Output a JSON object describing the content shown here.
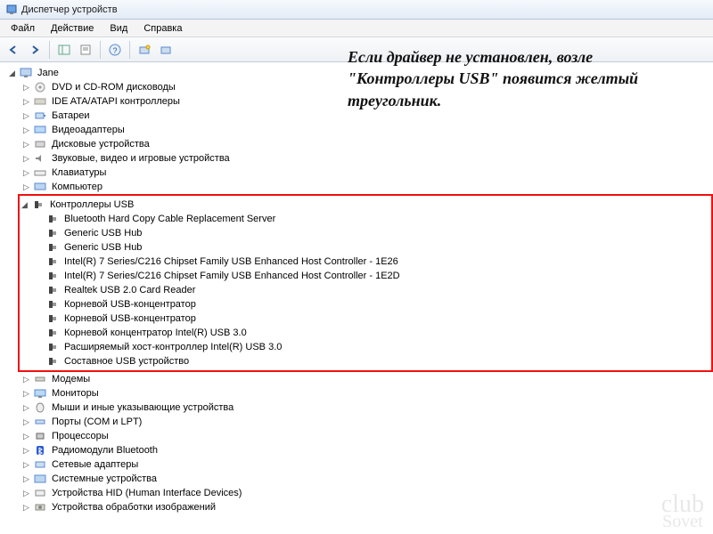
{
  "window": {
    "title": "Диспетчер устройств"
  },
  "menu": {
    "file": "Файл",
    "action": "Действие",
    "view": "Вид",
    "help": "Справка"
  },
  "tree": {
    "root": "Jane",
    "dvd": "DVD и CD-ROM дисководы",
    "ide": "IDE ATA/ATAPI контроллеры",
    "battery": "Батареи",
    "video": "Видеоадаптеры",
    "diskdrives": "Дисковые устройства",
    "sound": "Звуковые, видео и игровые устройства",
    "keyboard": "Клавиатуры",
    "computer": "Компьютер",
    "usb": "Контроллеры USB",
    "usb_items": [
      "Bluetooth Hard Copy Cable Replacement Server",
      "Generic USB Hub",
      "Generic USB Hub",
      "Intel(R) 7 Series/C216 Chipset Family USB Enhanced Host Controller - 1E26",
      "Intel(R) 7 Series/C216 Chipset Family USB Enhanced Host Controller - 1E2D",
      "Realtek USB 2.0 Card Reader",
      "Корневой USB-концентратор",
      "Корневой USB-концентратор",
      "Корневой концентратор Intel(R) USB 3.0",
      "Расширяемый хост-контроллер Intel(R) USB 3.0",
      "Составное USB устройство"
    ],
    "modems": "Модемы",
    "monitors": "Мониторы",
    "mice": "Мыши и иные указывающие устройства",
    "ports": "Порты (COM и LPT)",
    "cpu": "Процессоры",
    "bluetooth": "Радиомодули Bluetooth",
    "network": "Сетевые адаптеры",
    "system": "Системные устройства",
    "hid": "Устройства HID (Human Interface Devices)",
    "imaging": "Устройства обработки изображений"
  },
  "annotation": "Если драйвер не установлен, возле \"Контроллеры USB\" появится желтый треугольник.",
  "watermark": {
    "line1": "club",
    "line2": "Sovet"
  }
}
